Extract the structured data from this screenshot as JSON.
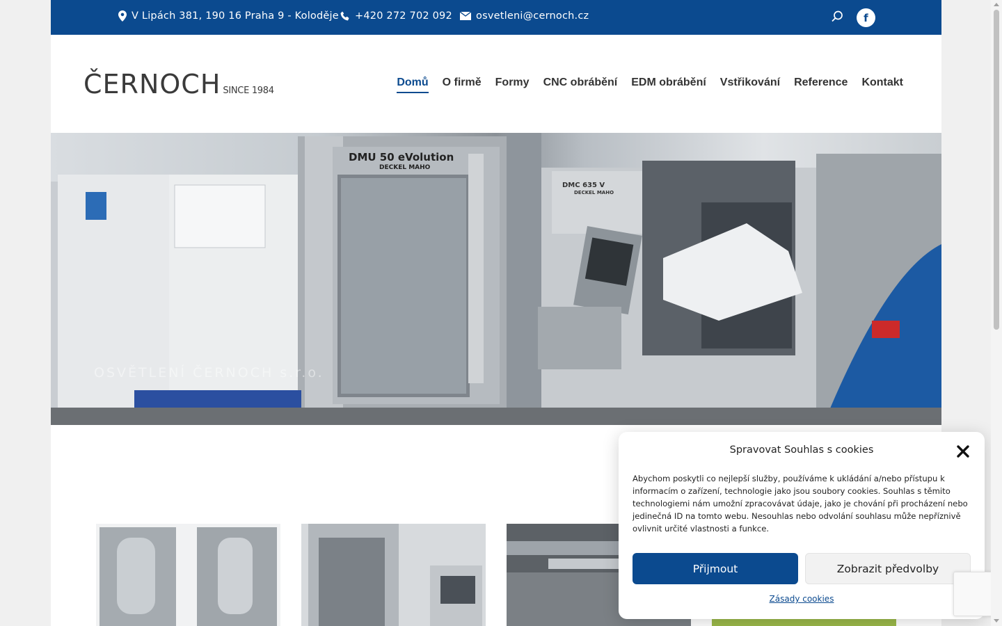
{
  "topbar": {
    "address": "V Lipách 381, 190 16 Praha 9 - Koloděje",
    "phone": "+420 272 702 092",
    "email": "osvetleni@cernoch.cz",
    "facebook_label": "f"
  },
  "logo": {
    "main": "ČERNOCH",
    "since": "SINCE 1984"
  },
  "nav": {
    "items": [
      {
        "label": "Domů",
        "active": true
      },
      {
        "label": "O firmě"
      },
      {
        "label": "Formy"
      },
      {
        "label": "CNC obrábění"
      },
      {
        "label": "EDM obrábění"
      },
      {
        "label": "Vstřikování"
      },
      {
        "label": "Reference"
      },
      {
        "label": "Kontakt"
      }
    ]
  },
  "hero": {
    "machine1_label": "DMU 50 eVolution",
    "machine1_brand": "DECKEL MAHO",
    "machine2_label": "DMC 635 V",
    "machine2_brand": "DECKEL MAHO",
    "overlay_subtitle": "OSVĚTLENÍ ČERNOCH s.r.o."
  },
  "cookie": {
    "title": "Spravovat Souhlas s cookies",
    "text": "Abychom poskytli co nejlepší služby, používáme k ukládání a/nebo přístupu k informacím o zařízení, technologie jako jsou soubory cookies. Souhlas s těmito technologiemi nám umožní zpracovávat údaje, jako je chování při procházení nebo jedinečná ID na tomto webu. Nesouhlas nebo odvolání souhlasu může nepříznivě ovlivnit určité vlastnosti a funkce.",
    "accept": "Přijmout",
    "preferences": "Zobrazit předvolby",
    "policy_link": "Zásady cookies"
  },
  "colors": {
    "brand_blue": "#0b4a8f",
    "nav_text": "#333333"
  },
  "icons": [
    "map-pin-icon",
    "phone-icon",
    "mail-icon",
    "search-icon",
    "facebook-icon",
    "close-icon"
  ]
}
